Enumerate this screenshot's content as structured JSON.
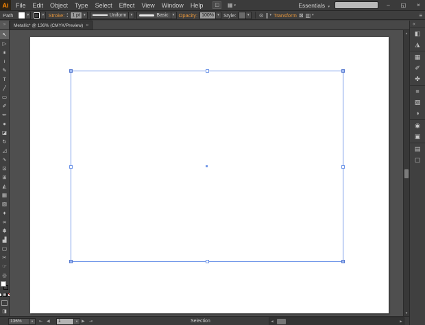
{
  "ui": {
    "dropdown_arrow": "▾"
  },
  "menubar": {
    "logo_text": "Ai",
    "items": [
      {
        "name": "file",
        "label": "File"
      },
      {
        "name": "edit",
        "label": "Edit"
      },
      {
        "name": "object",
        "label": "Object"
      },
      {
        "name": "type",
        "label": "Type"
      },
      {
        "name": "select",
        "label": "Select"
      },
      {
        "name": "effect",
        "label": "Effect"
      },
      {
        "name": "view",
        "label": "View"
      },
      {
        "name": "window",
        "label": "Window"
      },
      {
        "name": "help",
        "label": "Help"
      }
    ],
    "bridge_icon": "◫",
    "arrange_documents_icon": "▦",
    "workspace_label": "Essentials",
    "search_value": "",
    "window_controls": {
      "minimize": "–",
      "restore": "◱",
      "close": "×"
    }
  },
  "controlbar": {
    "selection_type_label": "Path",
    "stroke_link": "Stroke:",
    "stroke_width_value": "1 pt",
    "stroke_profile": "Uniform",
    "brush_definition": "Basic",
    "opacity_link": "Opacity:",
    "opacity_value": "100%",
    "style_label": "Style:",
    "transform_link": "Transform",
    "recolor_icon": "⊙",
    "align_icon": "∥",
    "isolate_icon": "⊠",
    "select_similar_icon": "▥",
    "panel_menu_icon": "≡",
    "stepper_up": "▴",
    "stepper_down": "▾"
  },
  "tabbar": {
    "document_tab": "Metallic* @ 136% (CMYK/Preview)",
    "close_glyph": "×"
  },
  "toolbar": {
    "collapse_icon": "»",
    "tools": [
      {
        "name": "selection-tool",
        "glyph": "↖",
        "active": true
      },
      {
        "name": "direct-selection-tool",
        "glyph": "▷"
      },
      {
        "name": "magic-wand-tool",
        "glyph": "∗"
      },
      {
        "name": "lasso-tool",
        "glyph": "≀"
      },
      {
        "name": "pen-tool",
        "glyph": "✎"
      },
      {
        "name": "type-tool",
        "glyph": "T"
      },
      {
        "name": "line-segment-tool",
        "glyph": "╱"
      },
      {
        "name": "rectangle-tool",
        "glyph": "▭"
      },
      {
        "name": "paintbrush-tool",
        "glyph": "✐"
      },
      {
        "name": "pencil-tool",
        "glyph": "✏"
      },
      {
        "name": "blob-brush-tool",
        "glyph": "●"
      },
      {
        "name": "eraser-tool",
        "glyph": "◪"
      },
      {
        "name": "rotate-tool",
        "glyph": "↻"
      },
      {
        "name": "scale-tool",
        "glyph": "◿"
      },
      {
        "name": "width-tool",
        "glyph": "∿"
      },
      {
        "name": "free-transform-tool",
        "glyph": "⊡"
      },
      {
        "name": "shape-builder-tool",
        "glyph": "⊞"
      },
      {
        "name": "perspective-grid-tool",
        "glyph": "◭"
      },
      {
        "name": "mesh-tool",
        "glyph": "▦"
      },
      {
        "name": "gradient-tool",
        "glyph": "▧"
      },
      {
        "name": "eyedropper-tool",
        "glyph": "♦"
      },
      {
        "name": "blend-tool",
        "glyph": "∞"
      },
      {
        "name": "symbol-sprayer-tool",
        "glyph": "✽"
      },
      {
        "name": "column-graph-tool",
        "glyph": "▟"
      },
      {
        "name": "artboard-tool",
        "glyph": "▢"
      },
      {
        "name": "slice-tool",
        "glyph": "✂"
      },
      {
        "name": "hand-tool",
        "glyph": "☞"
      },
      {
        "name": "zoom-tool",
        "glyph": "◎"
      }
    ]
  },
  "dock": {
    "collapse_icon": "«",
    "icons": [
      {
        "name": "color-panel",
        "glyph": "◧"
      },
      {
        "name": "color-guide-panel",
        "glyph": "◮"
      },
      {
        "name": "swatches-panel",
        "glyph": "▦",
        "sep": true
      },
      {
        "name": "brushes-panel",
        "glyph": "✐"
      },
      {
        "name": "symbols-panel",
        "glyph": "✤"
      },
      {
        "name": "stroke-panel",
        "glyph": "≡",
        "sep": true
      },
      {
        "name": "gradient-panel",
        "glyph": "▧"
      },
      {
        "name": "transparency-panel",
        "glyph": "◑"
      },
      {
        "name": "appearance-panel",
        "glyph": "◉",
        "sep": true
      },
      {
        "name": "graphic-styles-panel",
        "glyph": "▣"
      },
      {
        "name": "layers-panel",
        "glyph": "▤",
        "sep": true
      },
      {
        "name": "artboards-panel",
        "glyph": "▢"
      }
    ]
  },
  "canvas": {
    "selection_color": "#7096e8",
    "artboard_color": "#ffffff"
  },
  "statusbar": {
    "zoom_value": "136%",
    "artboard_number": "1",
    "tool_status": "Selection",
    "first_icon": "⇤",
    "prev_icon": "◀",
    "next_icon": "▶",
    "last_icon": "⇥"
  }
}
